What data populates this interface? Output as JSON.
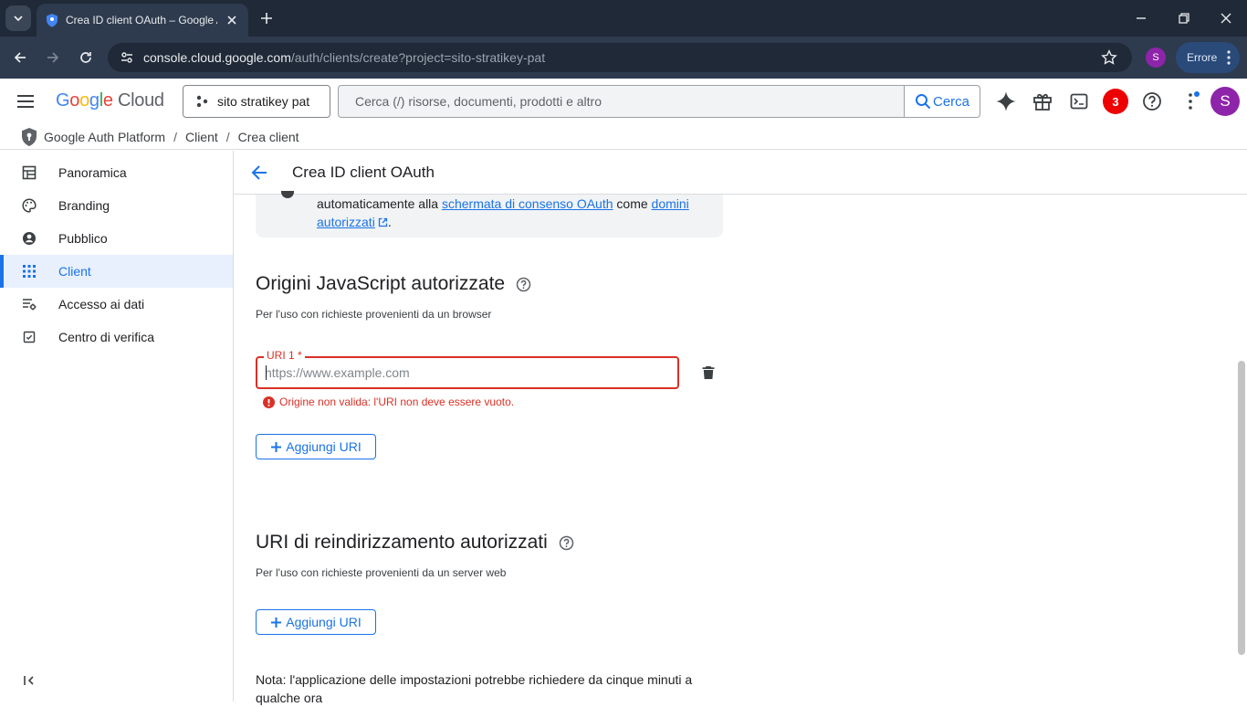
{
  "browser": {
    "tab_title": "Crea ID client OAuth – Google Auth Platform",
    "url_host": "console.cloud.google.com",
    "url_path": "/auth/clients/create?project=sito-stratikey-pat",
    "profile_initial": "S",
    "error_chip_label": "Errore"
  },
  "header": {
    "logo_google": "Google",
    "logo_cloud": "Cloud",
    "project_name": "sito stratikey pat",
    "search_placeholder": "Cerca (/) risorse, documenti, prodotti e altro",
    "search_button": "Cerca",
    "notification_count": "3",
    "avatar_initial": "S"
  },
  "breadcrumb": [
    "Google Auth Platform",
    "Client",
    "Crea client"
  ],
  "sidebar": {
    "items": [
      {
        "label": "Panoramica",
        "icon": "dashboard-icon"
      },
      {
        "label": "Branding",
        "icon": "palette-icon"
      },
      {
        "label": "Pubblico",
        "icon": "account-circle-icon"
      },
      {
        "label": "Client",
        "icon": "grid-icon",
        "active": true
      },
      {
        "label": "Accesso ai dati",
        "icon": "data-access-icon"
      },
      {
        "label": "Centro di verifica",
        "icon": "verification-icon"
      }
    ]
  },
  "page": {
    "title": "Crea ID client OAuth",
    "info": {
      "text_before": "automaticamente alla ",
      "link1": "schermata di consenso OAuth",
      "text_mid": " come ",
      "link2_part1": "domini",
      "link2_part2": "autorizzati",
      "text_after": "."
    },
    "js_origins": {
      "title": "Origini JavaScript autorizzate",
      "subtitle": "Per l'uso con richieste provenienti da un browser",
      "field_label": "URI 1 *",
      "field_placeholder": "https://www.example.com",
      "field_value": "",
      "error": "Origine non valida: l'URI non deve essere vuoto.",
      "add_button": "Aggiungi URI"
    },
    "redirect_uris": {
      "title": "URI di reindirizzamento autorizzati",
      "subtitle": "Per l'uso con richieste provenienti da un server web",
      "add_button": "Aggiungi URI"
    },
    "note": "Nota: l'applicazione delle impostazioni potrebbe richiedere da cinque minuti a qualche ora"
  },
  "colors": {
    "accent": "#1a73e8",
    "error": "#d93025",
    "chrome_dark": "#1f2937",
    "nav_active_bg": "#e8f0fe"
  }
}
